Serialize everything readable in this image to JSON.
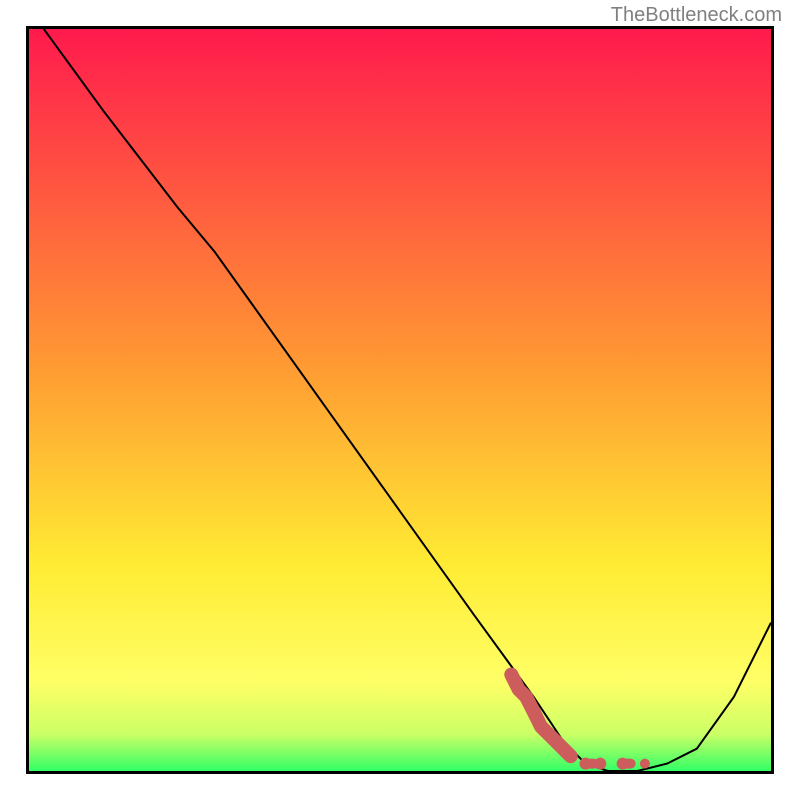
{
  "watermark": "TheBottleneck.com",
  "chart_data": {
    "type": "line",
    "title": "",
    "xlabel": "",
    "ylabel": "",
    "xlim": [
      0,
      100
    ],
    "ylim": [
      0,
      100
    ],
    "grid": false,
    "legend": false,
    "series": [
      {
        "name": "bottleneck-curve",
        "color": "#000000",
        "x": [
          2,
          10,
          20,
          25,
          30,
          40,
          50,
          60,
          68,
          72,
          75,
          78,
          82,
          86,
          90,
          95,
          100
        ],
        "y": [
          100,
          89,
          76,
          70,
          63,
          49,
          35,
          21,
          10,
          4,
          1,
          0,
          0,
          1,
          3,
          10,
          20
        ]
      },
      {
        "name": "highlighted-region",
        "color": "#cd5c5c",
        "type": "scatter",
        "x": [
          65,
          66,
          67,
          68,
          69,
          70,
          71,
          72,
          73,
          75,
          77,
          80,
          83
        ],
        "y": [
          13,
          11,
          10,
          8,
          6,
          5,
          4,
          3,
          2,
          1,
          1,
          1,
          1
        ]
      }
    ],
    "background_gradient": {
      "type": "vertical",
      "stops": [
        {
          "offset": 0,
          "color": "#ff1a4d"
        },
        {
          "offset": 0.45,
          "color": "#ff9933"
        },
        {
          "offset": 0.72,
          "color": "#ffeb33"
        },
        {
          "offset": 0.88,
          "color": "#ffff66"
        },
        {
          "offset": 0.95,
          "color": "#ccff66"
        },
        {
          "offset": 1.0,
          "color": "#33ff66"
        }
      ]
    }
  }
}
